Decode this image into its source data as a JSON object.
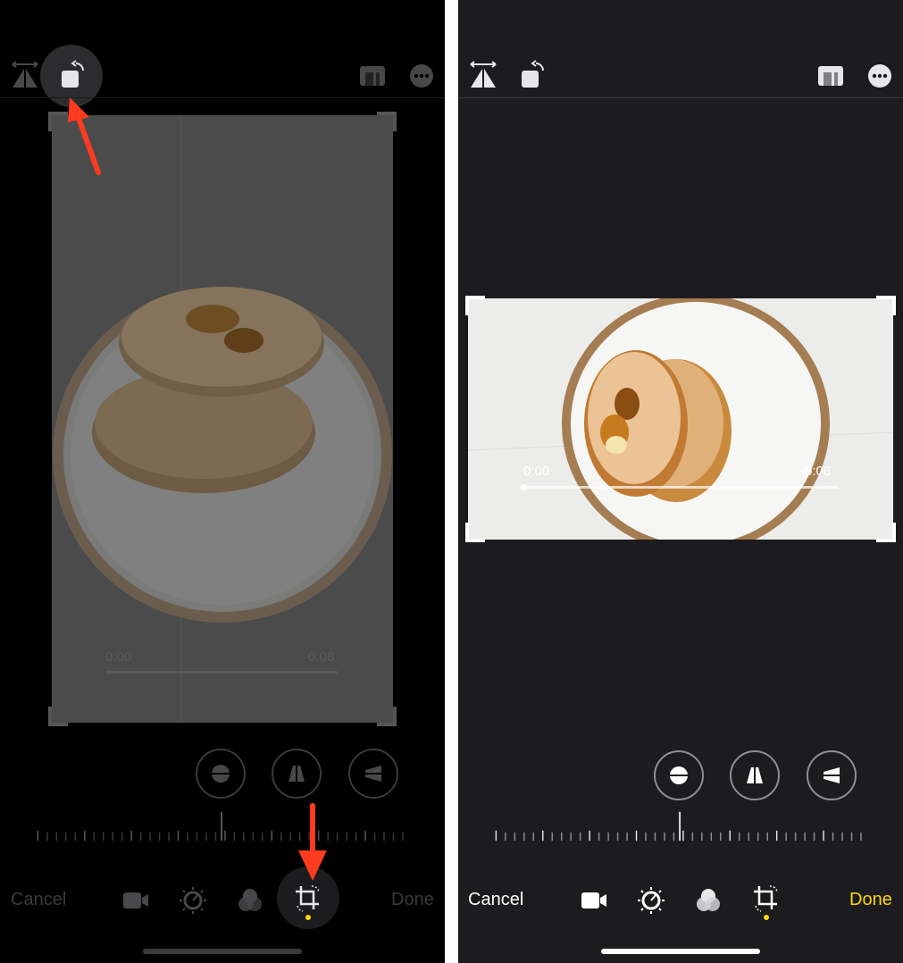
{
  "left": {
    "footer": {
      "cancel_label": "Cancel",
      "done_label": "Done"
    },
    "video": {
      "time_start": "0:00",
      "time_end": "-0:08"
    }
  },
  "right": {
    "footer": {
      "cancel_label": "Cancel",
      "done_label": "Done"
    },
    "video": {
      "time_start": "0:00",
      "time_end": "-0:08"
    }
  },
  "colors": {
    "accent": "#ffd60a",
    "annotation_arrow": "#ff3b1f"
  },
  "icons": [
    "flip-icon",
    "rotate-icon",
    "aspect-ratio-icon",
    "more-icon",
    "straighten-icon",
    "vertical-perspective-icon",
    "horizontal-perspective-icon",
    "video-icon",
    "adjust-icon",
    "filters-icon",
    "crop-icon"
  ]
}
